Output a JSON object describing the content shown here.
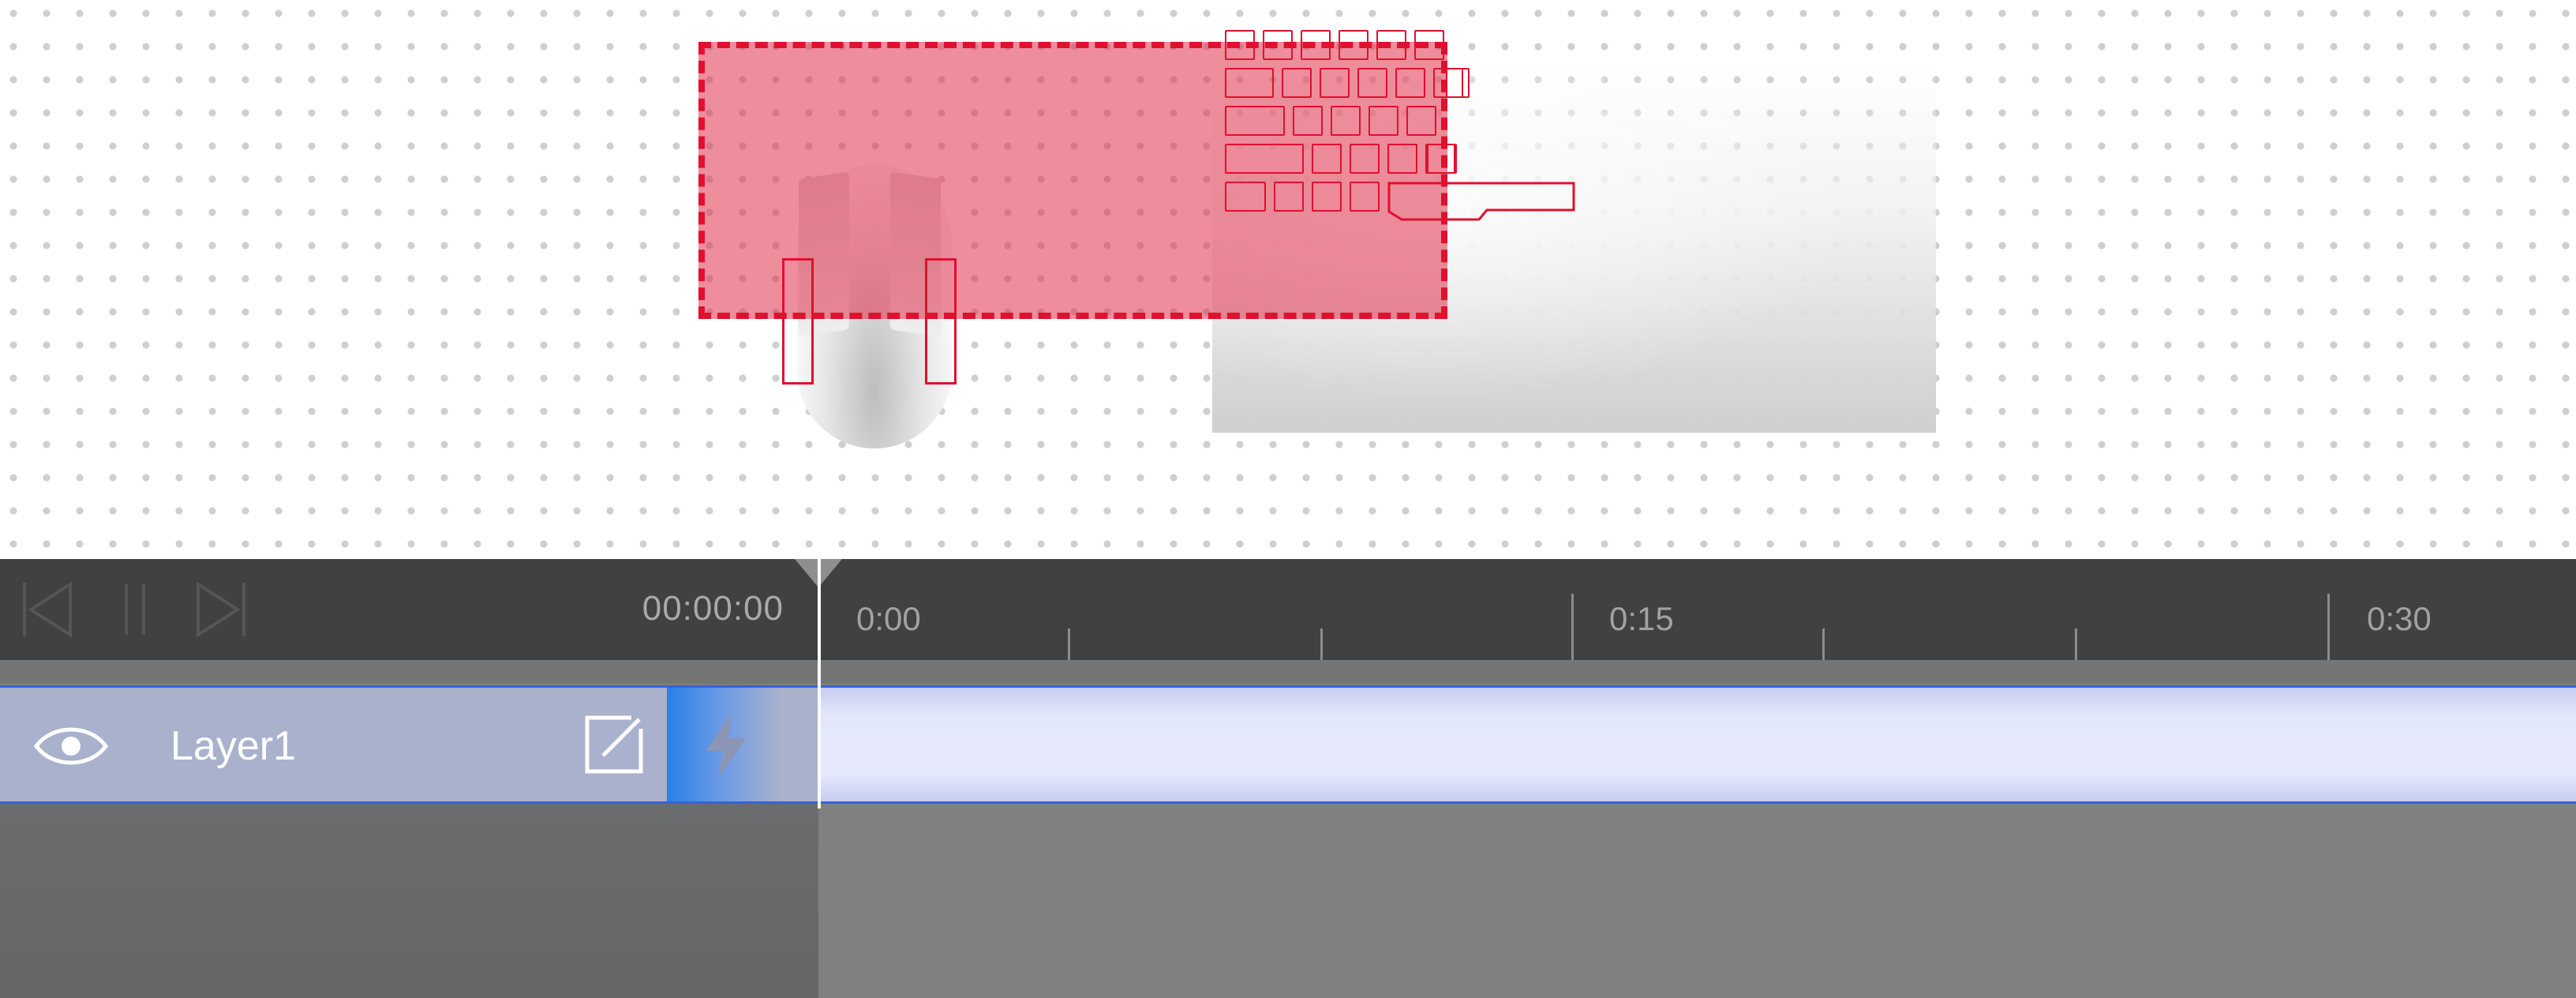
{
  "canvas": {
    "background": "#ffffff",
    "dot_color": "#cfcfcf",
    "objects": [
      {
        "name": "keyboard",
        "icon": "keyboard-illustration"
      },
      {
        "name": "mouse",
        "icon": "mouse-illustration"
      }
    ],
    "selection_color": "#e0102e"
  },
  "transport": {
    "buttons": [
      {
        "name": "skip-back",
        "icon": "skip-back-icon"
      },
      {
        "name": "pause",
        "icon": "pause-icon"
      },
      {
        "name": "skip-forward",
        "icon": "skip-forward-icon"
      }
    ],
    "time": "00:00:00"
  },
  "ruler": {
    "labels": [
      "0:00",
      "0:15",
      "0:30"
    ]
  },
  "layers": [
    {
      "name": "Layer1",
      "visible": true,
      "visibility_icon": "eye-icon",
      "edit_icon": "edit-icon",
      "action_icon": "lightning-icon",
      "selected": true,
      "accent": "#3a5fe0"
    }
  ]
}
